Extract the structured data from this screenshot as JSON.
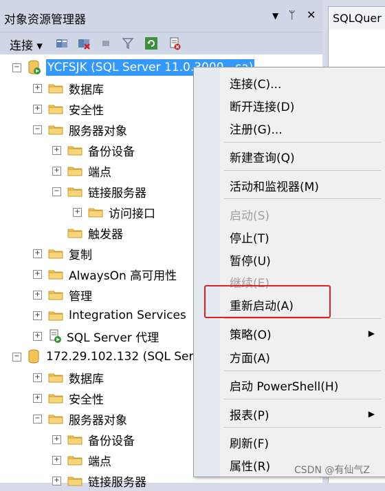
{
  "panel": {
    "title": "对象资源管理器",
    "pin_glyph": "▼",
    "dock_glyph": "ᛘ",
    "close_glyph": "✕"
  },
  "toolbar": {
    "connect_label": "连接 ▾"
  },
  "document_tab": {
    "label": "SQLQuer"
  },
  "tree": [
    {
      "label": "YCFSJK (SQL Server 11.0.3000 - sa)",
      "exp": "−",
      "type": "server",
      "selected": true
    },
    {
      "label": "数据库",
      "exp": "+",
      "type": "folder"
    },
    {
      "label": "安全性",
      "exp": "+",
      "type": "folder"
    },
    {
      "label": "服务器对象",
      "exp": "−",
      "type": "folder"
    },
    {
      "label": "备份设备",
      "exp": "+",
      "type": "folder"
    },
    {
      "label": "端点",
      "exp": "+",
      "type": "folder"
    },
    {
      "label": "链接服务器",
      "exp": "−",
      "type": "folder"
    },
    {
      "label": "访问接口",
      "exp": "+",
      "type": "folder"
    },
    {
      "label": "触发器",
      "exp": "",
      "type": "folder"
    },
    {
      "label": "复制",
      "exp": "+",
      "type": "folder"
    },
    {
      "label": "AlwaysOn 高可用性",
      "exp": "+",
      "type": "folder"
    },
    {
      "label": "管理",
      "exp": "+",
      "type": "folder"
    },
    {
      "label": "Integration Services",
      "exp": "+",
      "type": "folder"
    },
    {
      "label": "SQL Server 代理",
      "exp": "+",
      "type": "agent"
    },
    {
      "label": "172.29.102.132 (SQL Server)",
      "exp": "−",
      "type": "server2"
    },
    {
      "label": "数据库",
      "exp": "+",
      "type": "folder"
    },
    {
      "label": "安全性",
      "exp": "+",
      "type": "folder"
    },
    {
      "label": "服务器对象",
      "exp": "−",
      "type": "folder"
    },
    {
      "label": "备份设备",
      "exp": "+",
      "type": "folder"
    },
    {
      "label": "端点",
      "exp": "+",
      "type": "folder"
    },
    {
      "label": "链接服务器",
      "exp": "+",
      "type": "folder"
    }
  ],
  "context_menu": {
    "connect": "连接(C)...",
    "disconnect": "断开连接(D)",
    "register": "注册(G)...",
    "new_query": "新建查询(Q)",
    "activity_monitor": "活动和监视器(M)",
    "start": "启动(S)",
    "stop": "停止(T)",
    "pause": "暂停(U)",
    "resume": "继续(E)",
    "restart": "重新启动(A)",
    "policies": "策略(O)",
    "facets": "方面(A)",
    "powershell": "启动 PowerShell(H)",
    "reports": "报表(P)",
    "refresh": "刷新(F)",
    "properties": "属性(R)",
    "submenu_arrow": "▶"
  },
  "watermark": "CSDN @有仙气Z",
  "colors": {
    "selection": "#3399ff",
    "highlight_box": "#e02020",
    "folder": "#f2c55c"
  }
}
